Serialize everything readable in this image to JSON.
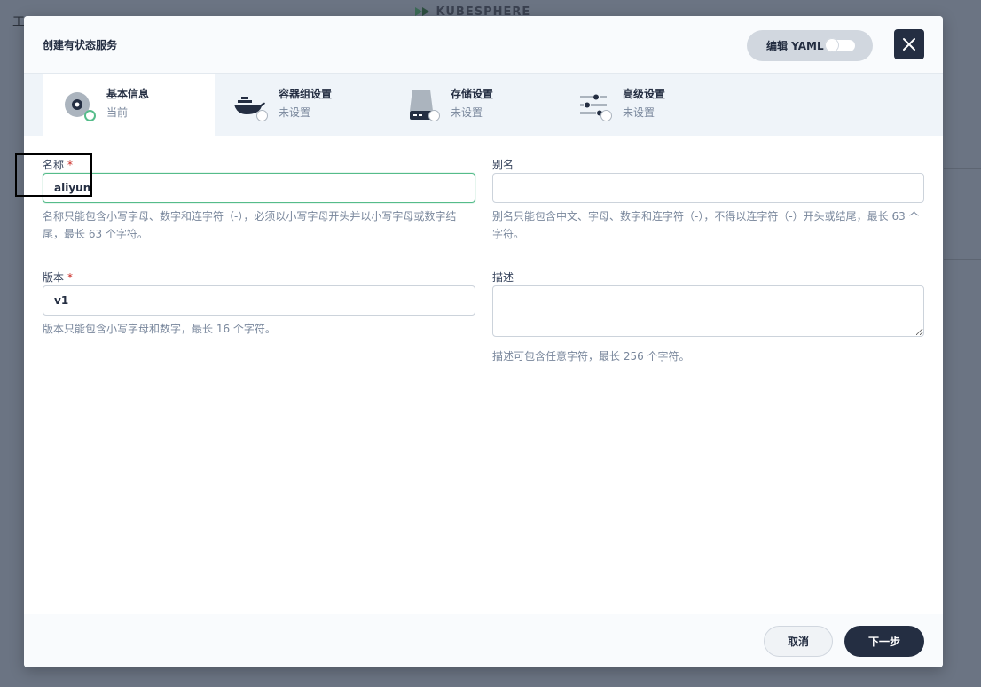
{
  "backdrop": {
    "corner_char": "工",
    "logo_text": "KUBESPHERE"
  },
  "modal": {
    "title": "创建有状态服务",
    "edit_yaml_label": "编辑 YAML"
  },
  "steps": [
    {
      "title": "基本信息",
      "status": "当前",
      "icon": "settings-disc-icon"
    },
    {
      "title": "容器组设置",
      "status": "未设置",
      "icon": "docker-whale-icon"
    },
    {
      "title": "存储设置",
      "status": "未设置",
      "icon": "storage-drive-icon"
    },
    {
      "title": "高级设置",
      "status": "未设置",
      "icon": "sliders-icon"
    }
  ],
  "form": {
    "name": {
      "label": "名称",
      "required_mark": "*",
      "value": "aliyun",
      "description": "名称只能包含小写字母、数字和连字符（-），必须以小写字母开头并以小写字母或数字结尾，最长 63 个字符。"
    },
    "alias": {
      "label": "别名",
      "value": "",
      "description": "别名只能包含中文、字母、数字和连字符（-），不得以连字符（-）开头或结尾，最长 63 个字符。"
    },
    "version": {
      "label": "版本",
      "required_mark": "*",
      "value": "v1",
      "description": "版本只能包含小写字母和数字，最长 16 个字符。"
    },
    "description": {
      "label": "描述",
      "value": "",
      "description": "描述可包含任意字符，最长 256 个字符。"
    }
  },
  "footer": {
    "cancel_label": "取消",
    "next_label": "下一步"
  },
  "colors": {
    "primary_dark": "#242e42",
    "success_green": "#55bc8a",
    "required_red": "#ca2621",
    "muted_text": "#79879c"
  }
}
